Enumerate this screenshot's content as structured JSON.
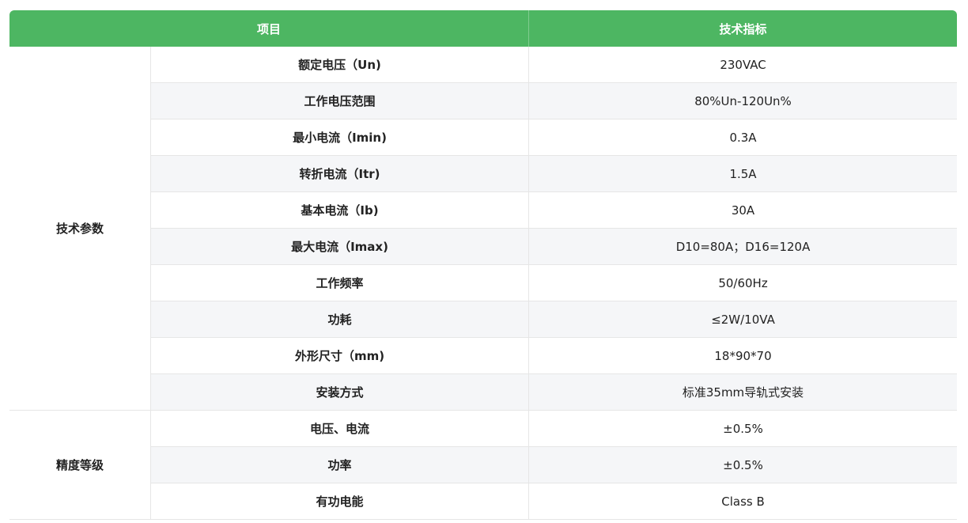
{
  "table": {
    "headers": {
      "item": "项目",
      "spec": "技术指标"
    },
    "groups": [
      {
        "label": "技术参数",
        "rows": [
          {
            "param": "额定电压（Un)",
            "value": "230VAC"
          },
          {
            "param": "工作电压范围",
            "value": "80%Un-120Un%"
          },
          {
            "param": "最小电流（Imin)",
            "value": "0.3A"
          },
          {
            "param": "转折电流（Itr)",
            "value": "1.5A"
          },
          {
            "param": "基本电流（Ib)",
            "value": "30A"
          },
          {
            "param": "最大电流（Imax)",
            "value": "D10=80A；D16=120A"
          },
          {
            "param": "工作频率",
            "value": "50/60Hz"
          },
          {
            "param": "功耗",
            "value": "≤2W/10VA"
          },
          {
            "param": "外形尺寸（mm)",
            "value": "18*90*70"
          },
          {
            "param": "安装方式",
            "value": "标准35mm导轨式安装"
          }
        ]
      },
      {
        "label": "精度等级",
        "rows": [
          {
            "param": "电压、电流",
            "value": "±0.5%"
          },
          {
            "param": "功率",
            "value": "±0.5%"
          },
          {
            "param": "有功电能",
            "value": "Class B"
          }
        ]
      }
    ]
  },
  "colors": {
    "header_bg": "#4db662",
    "header_text": "#ffffff",
    "stripe_bg": "#f5f6f8",
    "border": "#e6e6e6"
  }
}
